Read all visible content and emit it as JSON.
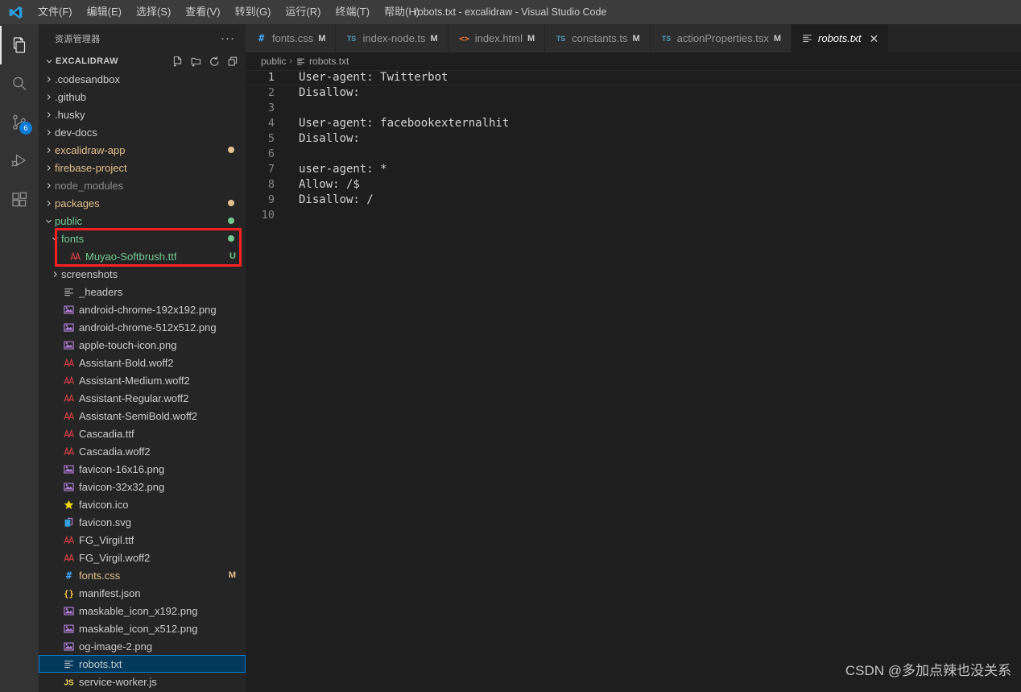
{
  "window": {
    "title": "robots.txt - excalidraw - Visual Studio Code",
    "logo_icon": "vscode-logo"
  },
  "menubar": {
    "items": [
      {
        "label": "文件(F)",
        "name": "menu-file"
      },
      {
        "label": "编辑(E)",
        "name": "menu-edit"
      },
      {
        "label": "选择(S)",
        "name": "menu-selection"
      },
      {
        "label": "查看(V)",
        "name": "menu-view"
      },
      {
        "label": "转到(G)",
        "name": "menu-go"
      },
      {
        "label": "运行(R)",
        "name": "menu-run"
      },
      {
        "label": "终端(T)",
        "name": "menu-terminal"
      },
      {
        "label": "帮助(H)",
        "name": "menu-help"
      }
    ]
  },
  "activitybar": {
    "items": [
      {
        "icon": "files-explorer-icon",
        "name": "activity-explorer",
        "active": true,
        "badge": ""
      },
      {
        "icon": "search-icon",
        "name": "activity-search",
        "active": false,
        "badge": ""
      },
      {
        "icon": "source-control-icon",
        "name": "activity-source-control",
        "active": false,
        "badge": "6"
      },
      {
        "icon": "run-debug-icon",
        "name": "activity-run-debug",
        "active": false,
        "badge": ""
      },
      {
        "icon": "extensions-icon",
        "name": "activity-extensions",
        "active": false,
        "badge": ""
      }
    ]
  },
  "sidebar": {
    "title": "资源管理器",
    "more_actions": "···",
    "section": {
      "label": "EXCALIDRAW",
      "expanded": true,
      "actions": [
        {
          "icon": "new-file-icon",
          "name": "new-file-button"
        },
        {
          "icon": "new-folder-icon",
          "name": "new-folder-button"
        },
        {
          "icon": "refresh-icon",
          "name": "refresh-explorer-button"
        },
        {
          "icon": "collapse-all-icon",
          "name": "collapse-all-button"
        }
      ]
    },
    "tree": [
      {
        "label": ".codesandbox",
        "type": "folder",
        "expanded": false,
        "indent": 1,
        "color": "white",
        "decor": "",
        "dot": ""
      },
      {
        "label": ".github",
        "type": "folder",
        "expanded": false,
        "indent": 1,
        "color": "white",
        "decor": "",
        "dot": ""
      },
      {
        "label": ".husky",
        "type": "folder",
        "expanded": false,
        "indent": 1,
        "color": "white",
        "decor": "",
        "dot": ""
      },
      {
        "label": "dev-docs",
        "type": "folder",
        "expanded": false,
        "indent": 1,
        "color": "white",
        "decor": "",
        "dot": ""
      },
      {
        "label": "excalidraw-app",
        "type": "folder",
        "expanded": false,
        "indent": 1,
        "color": "yellow",
        "decor": "",
        "dot": "#e2c08d"
      },
      {
        "label": "firebase-project",
        "type": "folder",
        "expanded": false,
        "indent": 1,
        "color": "yellow",
        "decor": "",
        "dot": ""
      },
      {
        "label": "node_modules",
        "type": "folder",
        "expanded": false,
        "indent": 1,
        "color": "grey",
        "decor": "",
        "dot": ""
      },
      {
        "label": "packages",
        "type": "folder",
        "expanded": false,
        "indent": 1,
        "color": "yellow",
        "decor": "",
        "dot": "#e2c08d"
      },
      {
        "label": "public",
        "type": "folder",
        "expanded": true,
        "indent": 1,
        "color": "green",
        "decor": "",
        "dot": "#73c991"
      },
      {
        "label": "fonts",
        "type": "folder",
        "expanded": true,
        "indent": 2,
        "color": "green",
        "decor": "",
        "dot": "#73c991"
      },
      {
        "label": "Muyao-Softbrush.ttf",
        "type": "font",
        "indent": 3,
        "color": "green",
        "decor": "U",
        "dot": ""
      },
      {
        "label": "screenshots",
        "type": "folder",
        "expanded": false,
        "indent": 2,
        "color": "white",
        "decor": "",
        "dot": ""
      },
      {
        "label": "_headers",
        "type": "text",
        "indent": 2,
        "color": "white",
        "decor": "",
        "dot": ""
      },
      {
        "label": "android-chrome-192x192.png",
        "type": "image",
        "indent": 2,
        "color": "white",
        "decor": "",
        "dot": ""
      },
      {
        "label": "android-chrome-512x512.png",
        "type": "image",
        "indent": 2,
        "color": "white",
        "decor": "",
        "dot": ""
      },
      {
        "label": "apple-touch-icon.png",
        "type": "image",
        "indent": 2,
        "color": "white",
        "decor": "",
        "dot": ""
      },
      {
        "label": "Assistant-Bold.woff2",
        "type": "font",
        "indent": 2,
        "color": "white",
        "decor": "",
        "dot": ""
      },
      {
        "label": "Assistant-Medium.woff2",
        "type": "font",
        "indent": 2,
        "color": "white",
        "decor": "",
        "dot": ""
      },
      {
        "label": "Assistant-Regular.woff2",
        "type": "font",
        "indent": 2,
        "color": "white",
        "decor": "",
        "dot": ""
      },
      {
        "label": "Assistant-SemiBold.woff2",
        "type": "font",
        "indent": 2,
        "color": "white",
        "decor": "",
        "dot": ""
      },
      {
        "label": "Cascadia.ttf",
        "type": "font",
        "indent": 2,
        "color": "white",
        "decor": "",
        "dot": ""
      },
      {
        "label": "Cascadia.woff2",
        "type": "font",
        "indent": 2,
        "color": "white",
        "decor": "",
        "dot": ""
      },
      {
        "label": "favicon-16x16.png",
        "type": "image",
        "indent": 2,
        "color": "white",
        "decor": "",
        "dot": ""
      },
      {
        "label": "favicon-32x32.png",
        "type": "image",
        "indent": 2,
        "color": "white",
        "decor": "",
        "dot": ""
      },
      {
        "label": "favicon.ico",
        "type": "ico",
        "indent": 2,
        "color": "white",
        "decor": "",
        "dot": ""
      },
      {
        "label": "favicon.svg",
        "type": "svg",
        "indent": 2,
        "color": "white",
        "decor": "",
        "dot": ""
      },
      {
        "label": "FG_Virgil.ttf",
        "type": "font",
        "indent": 2,
        "color": "white",
        "decor": "",
        "dot": ""
      },
      {
        "label": "FG_Virgil.woff2",
        "type": "font",
        "indent": 2,
        "color": "white",
        "decor": "",
        "dot": ""
      },
      {
        "label": "fonts.css",
        "type": "css",
        "indent": 2,
        "color": "yellow",
        "decor": "M",
        "dot": ""
      },
      {
        "label": "manifest.json",
        "type": "json",
        "indent": 2,
        "color": "white",
        "decor": "",
        "dot": ""
      },
      {
        "label": "maskable_icon_x192.png",
        "type": "image",
        "indent": 2,
        "color": "white",
        "decor": "",
        "dot": ""
      },
      {
        "label": "maskable_icon_x512.png",
        "type": "image",
        "indent": 2,
        "color": "white",
        "decor": "",
        "dot": ""
      },
      {
        "label": "og-image-2.png",
        "type": "image",
        "indent": 2,
        "color": "white",
        "decor": "",
        "dot": ""
      },
      {
        "label": "robots.txt",
        "type": "text",
        "indent": 2,
        "color": "white",
        "decor": "",
        "dot": "",
        "selected": true
      },
      {
        "label": "service-worker.js",
        "type": "js",
        "indent": 2,
        "color": "white",
        "decor": "",
        "dot": ""
      }
    ],
    "annotation": {
      "color": "#ff2121"
    }
  },
  "editor": {
    "tabs": [
      {
        "label": "fonts.css",
        "icon": "css-icon",
        "dirty": "M",
        "active": false,
        "name": "tab-fonts-css"
      },
      {
        "label": "index-node.ts",
        "icon": "ts-icon",
        "dirty": "M",
        "active": false,
        "name": "tab-index-node-ts"
      },
      {
        "label": "index.html",
        "icon": "html-icon",
        "dirty": "M",
        "active": false,
        "name": "tab-index-html"
      },
      {
        "label": "constants.ts",
        "icon": "ts-icon",
        "dirty": "M",
        "active": false,
        "name": "tab-constants-ts"
      },
      {
        "label": "actionProperties.tsx",
        "icon": "ts-icon",
        "dirty": "M",
        "active": false,
        "name": "tab-action-properties-tsx"
      },
      {
        "label": "robots.txt",
        "icon": "text-icon",
        "dirty": "",
        "active": true,
        "close": "✕",
        "name": "tab-robots-txt"
      }
    ],
    "breadcrumb": [
      {
        "label": "public",
        "icon": "",
        "name": "breadcrumb-public"
      },
      {
        "label": "robots.txt",
        "icon": "text-icon",
        "name": "breadcrumb-robots-txt"
      }
    ],
    "breadcrumb_separator": "›",
    "lines": [
      {
        "n": "1",
        "text": "User-agent: Twitterbot",
        "current": true
      },
      {
        "n": "2",
        "text": "Disallow:",
        "current": false
      },
      {
        "n": "3",
        "text": "",
        "current": false
      },
      {
        "n": "4",
        "text": "User-agent: facebookexternalhit",
        "current": false
      },
      {
        "n": "5",
        "text": "Disallow:",
        "current": false
      },
      {
        "n": "6",
        "text": "",
        "current": false
      },
      {
        "n": "7",
        "text": "user-agent: *",
        "current": false
      },
      {
        "n": "8",
        "text": "Allow: /$",
        "current": false
      },
      {
        "n": "9",
        "text": "Disallow: /",
        "current": false
      },
      {
        "n": "10",
        "text": "",
        "current": false
      }
    ]
  },
  "watermark": {
    "text": "CSDN @多加点辣也没关系"
  },
  "colors": {
    "titlebar_bg": "#3c3c3c",
    "activitybar_bg": "#333333",
    "sidebar_bg": "#252526",
    "editor_bg": "#1e1e1e",
    "tab_inactive_bg": "#2d2d2d",
    "selection_blue": "#04395e",
    "focus_border": "#007fd4",
    "badge_blue": "#0e7bd6",
    "git_modified": "#e2c08d",
    "git_untracked": "#73c991",
    "annotation_red": "#ff2121"
  }
}
